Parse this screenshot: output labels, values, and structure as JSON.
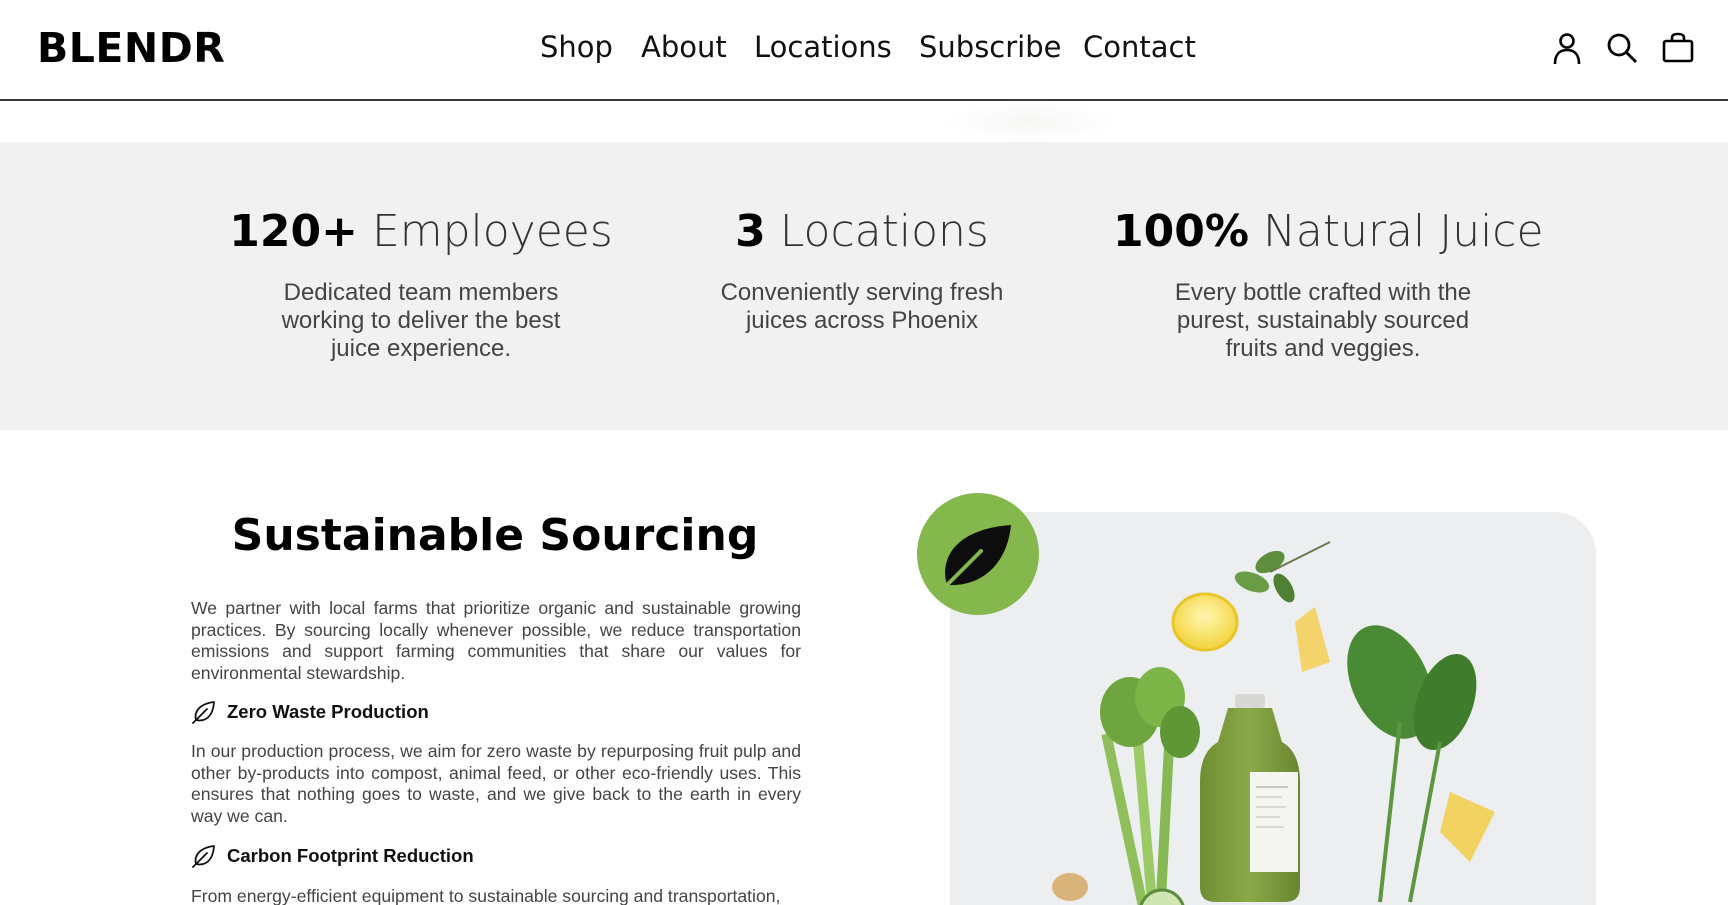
{
  "header": {
    "logo": "BLENDR",
    "nav": [
      {
        "label": "Shop"
      },
      {
        "label": "About"
      },
      {
        "label": "Locations"
      },
      {
        "label": "Subscribe"
      },
      {
        "label": "Contact"
      }
    ],
    "icons": [
      "account-icon",
      "search-icon",
      "cart-icon"
    ]
  },
  "stats": [
    {
      "number": "120+",
      "label": "Employees",
      "description": "Dedicated team members working to deliver the best juice experience."
    },
    {
      "number": "3",
      "label": "Locations",
      "description": "Conveniently serving fresh juices across Phoenix"
    },
    {
      "number": "100%",
      "label": "Natural Juice",
      "description": "Every bottle crafted with the purest, sustainably sourced fruits and veggies."
    }
  ],
  "sourcing": {
    "title": "Sustainable Sourcing",
    "intro": "We partner with local farms that prioritize organic and sustainable growing practices. By sourcing locally whenever possible, we reduce transportation emissions and support farming communities that share our values for environmental stewardship.",
    "features": [
      {
        "title": "Zero Waste Production",
        "text": "In our production process, we aim for zero waste by repurposing fruit pulp and other by-products into compost, animal feed, or other eco-friendly uses. This ensures that nothing goes to waste, and we give back to the earth in every way we can."
      },
      {
        "title": "Carbon Footprint Reduction",
        "text": "From energy-efficient equipment to sustainable sourcing and transportation,"
      }
    ]
  },
  "colors": {
    "accent_green": "#84b84c",
    "stats_band": "#f1f1f1",
    "juice_green": "#7c9b3e"
  }
}
